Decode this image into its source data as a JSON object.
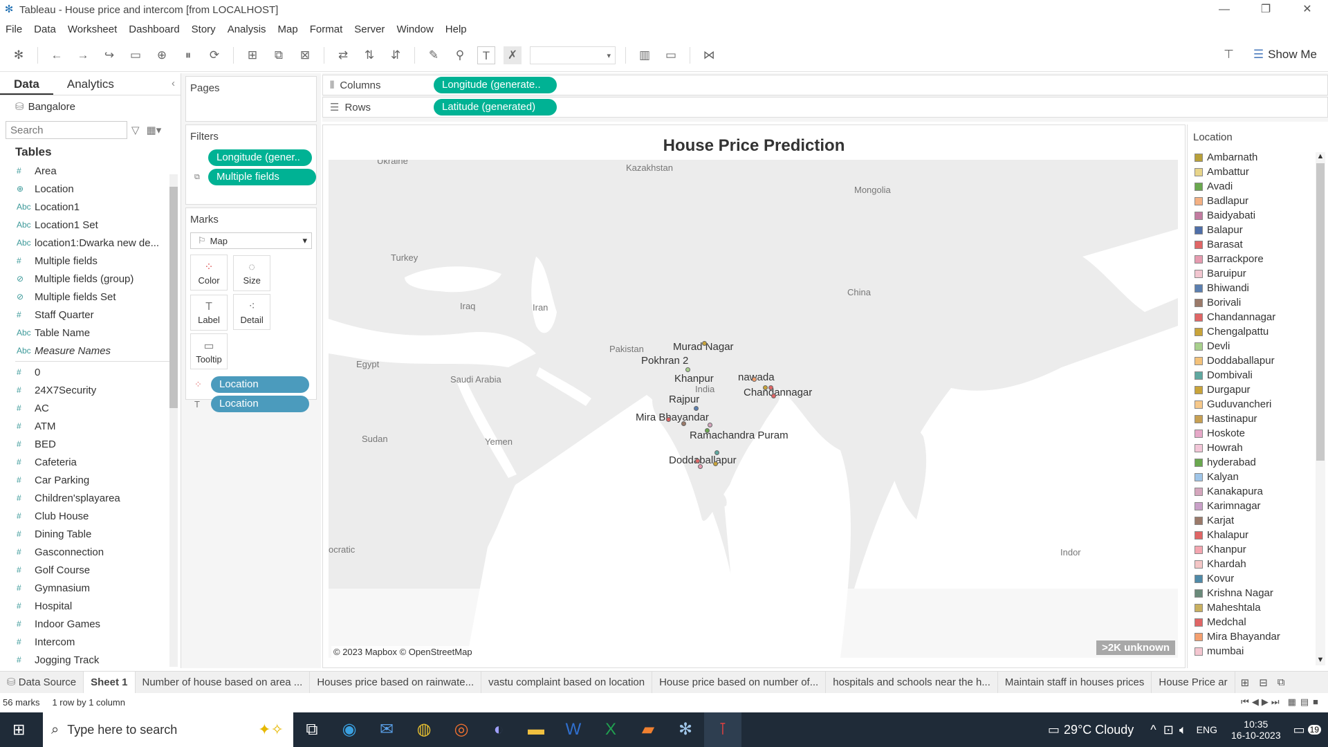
{
  "window": {
    "title": "Tableau - House price and intercom [from LOCALHOST]"
  },
  "menu": [
    "File",
    "Data",
    "Worksheet",
    "Dashboard",
    "Story",
    "Analysis",
    "Map",
    "Format",
    "Server",
    "Window",
    "Help"
  ],
  "showme": {
    "label": "Show Me"
  },
  "left": {
    "tabs": [
      "Data",
      "Analytics"
    ],
    "source": "Bangalore",
    "search_placeholder": "Search",
    "tables_header": "Tables",
    "fields": [
      {
        "icon": "#",
        "name": "Area"
      },
      {
        "icon": "⊕",
        "name": "Location"
      },
      {
        "icon": "Abc",
        "name": "Location1"
      },
      {
        "icon": "Abc",
        "name": "Location1 Set"
      },
      {
        "icon": "Abc",
        "name": "location1:Dwarka new de..."
      },
      {
        "icon": "#",
        "name": "Multiple fields"
      },
      {
        "icon": "⊘",
        "name": "Multiple fields (group)"
      },
      {
        "icon": "⊘",
        "name": "Multiple fields Set"
      },
      {
        "icon": "#",
        "name": "Staff Quarter"
      },
      {
        "icon": "Abc",
        "name": "Table Name"
      },
      {
        "icon": "Abc",
        "name": "Measure Names"
      }
    ],
    "measures": [
      "0",
      "24X7Security",
      "AC",
      "ATM",
      "BED",
      "Cafeteria",
      "Car Parking",
      "Children'splayarea",
      "Club House",
      "Dining Table",
      "Gasconnection",
      "Golf Course",
      "Gymnasium",
      "Hospital",
      "Indoor Games",
      "Intercom",
      "Jogging Track"
    ]
  },
  "pages": {
    "title": "Pages"
  },
  "filters": {
    "title": "Filters",
    "items": [
      "Longitude (gener..",
      "Multiple fields"
    ]
  },
  "marks": {
    "title": "Marks",
    "type": "Map",
    "buttons": [
      "Color",
      "Size",
      "Label",
      "Detail",
      "Tooltip"
    ],
    "pills": [
      "Location",
      "Location"
    ]
  },
  "shelves": {
    "columns_label": "Columns",
    "columns_pill": "Longitude (generate..",
    "rows_label": "Rows",
    "rows_pill": "Latitude (generated)"
  },
  "view": {
    "title": "House Price Prediction",
    "attribution": "© 2023 Mapbox © OpenStreetMap",
    "unknown": ">2K unknown"
  },
  "map_labels": [
    "Kazakhstan",
    "Mongolia",
    "Turkey",
    "China",
    "Iraq",
    "Iran",
    "Pakistan",
    "Egypt",
    "Saudi Arabia",
    "India",
    "Sudan",
    "Yemen",
    "Ukraine",
    "Murad Nagar",
    "Pokhran 2",
    "Khanpur",
    "nawada",
    "Chandannagar",
    "Rajpur",
    "Mira Bhayandar",
    "Ramachandra Puram",
    "Doddaballapur",
    "ocratic",
    "Indor"
  ],
  "legend": {
    "title": "Location",
    "items": [
      {
        "name": "Ambarnath",
        "color": "#b8a03a"
      },
      {
        "name": "Ambattur",
        "color": "#e8d58a"
      },
      {
        "name": "Avadi",
        "color": "#6aa84f"
      },
      {
        "name": "Badlapur",
        "color": "#f4b183"
      },
      {
        "name": "Baidyabati",
        "color": "#c27ba0"
      },
      {
        "name": "Balapur",
        "color": "#4f6fa8"
      },
      {
        "name": "Barasat",
        "color": "#e06666"
      },
      {
        "name": "Barrackpore",
        "color": "#e69bb0"
      },
      {
        "name": "Baruipur",
        "color": "#f2c6d0"
      },
      {
        "name": "Bhiwandi",
        "color": "#5b7fb0"
      },
      {
        "name": "Borivali",
        "color": "#9b7a6a"
      },
      {
        "name": "Chandannagar",
        "color": "#e06666"
      },
      {
        "name": "Chengalpattu",
        "color": "#c9a43a"
      },
      {
        "name": "Devli",
        "color": "#a8d08d"
      },
      {
        "name": "Doddaballapur",
        "color": "#f4c27a"
      },
      {
        "name": "Dombivali",
        "color": "#5fa8a0"
      },
      {
        "name": "Durgapur",
        "color": "#c9a43a"
      },
      {
        "name": "Guduvancheri",
        "color": "#f6c88a"
      },
      {
        "name": "Hastinapur",
        "color": "#c7a053"
      },
      {
        "name": "Hoskote",
        "color": "#e6a8c8"
      },
      {
        "name": "Howrah",
        "color": "#f2c6d8"
      },
      {
        "name": "hyderabad",
        "color": "#6aa84f"
      },
      {
        "name": "Kalyan",
        "color": "#9fc5e8"
      },
      {
        "name": "Kanakapura",
        "color": "#d5a6bd"
      },
      {
        "name": "Karimnagar",
        "color": "#c9a0c8"
      },
      {
        "name": "Karjat",
        "color": "#9b7a6a"
      },
      {
        "name": "Khalapur",
        "color": "#e06666"
      },
      {
        "name": "Khanpur",
        "color": "#f4a6b0"
      },
      {
        "name": "Khardah",
        "color": "#f4c6c6"
      },
      {
        "name": "Kovur",
        "color": "#4f8aa8"
      },
      {
        "name": "Krishna Nagar",
        "color": "#6a8a7a"
      },
      {
        "name": "Maheshtala",
        "color": "#c9b060"
      },
      {
        "name": "Medchal",
        "color": "#e06666"
      },
      {
        "name": "Mira Bhayandar",
        "color": "#f4a070"
      },
      {
        "name": "mumbai",
        "color": "#f4c6d0"
      }
    ]
  },
  "sheets": [
    "Data Source",
    "Sheet 1",
    "Number of house based on area ...",
    "Houses price based on rainwate...",
    "vastu complaint based on location",
    "House price based on number of...",
    "hospitals and schools near the h...",
    "Maintain staff in houses prices",
    "House Price ar"
  ],
  "status": {
    "marks": "56 marks",
    "rows": "1 row by 1 column"
  },
  "taskbar": {
    "search_placeholder": "Type here to search",
    "weather": "29°C  Cloudy",
    "lang": "ENG",
    "time": "10:35",
    "date": "16-10-2023",
    "notif": "19"
  }
}
